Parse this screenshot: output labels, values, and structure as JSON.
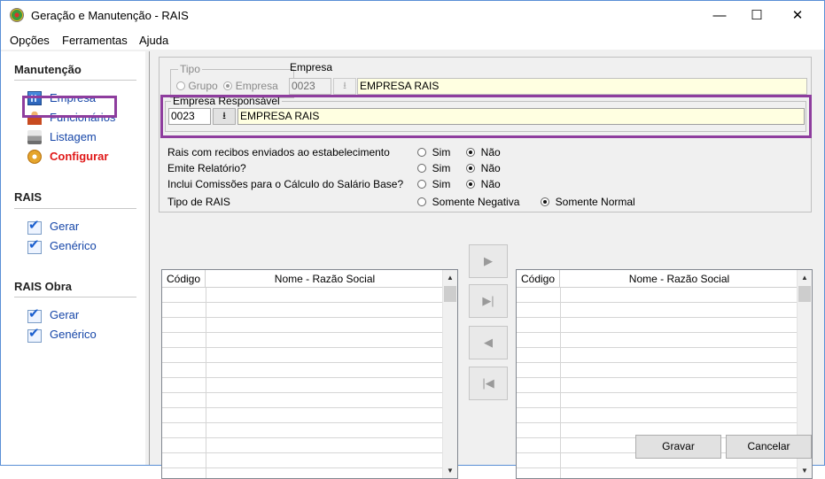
{
  "window": {
    "title": "Geração e Manutenção - RAIS",
    "minimize": "—",
    "maximize": "☐",
    "close": "✕"
  },
  "menu": {
    "items": [
      "Opções",
      "Ferramentas",
      "Ajuda"
    ]
  },
  "sidebar": {
    "sections": [
      {
        "title": "Manutenção",
        "items": [
          {
            "label": "Empresa",
            "icon": "building-icon"
          },
          {
            "label": "Funcionários",
            "icon": "person-icon"
          },
          {
            "label": "Listagem",
            "icon": "printer-icon"
          },
          {
            "label": "Configurar",
            "icon": "gear-icon",
            "active": true
          }
        ]
      },
      {
        "title": "RAIS",
        "items": [
          {
            "label": "Gerar",
            "icon": "checkbox-icon"
          },
          {
            "label": "Genérico",
            "icon": "checkbox-icon"
          }
        ]
      },
      {
        "title": "RAIS Obra",
        "items": [
          {
            "label": "Gerar",
            "icon": "checkbox-icon"
          },
          {
            "label": "Genérico",
            "icon": "checkbox-icon"
          }
        ]
      }
    ]
  },
  "config": {
    "tipo": {
      "legend": "Tipo",
      "grupo": "Grupo",
      "empresa": "Empresa",
      "selected": "Empresa"
    },
    "empresa": {
      "label": "Empresa",
      "code": "0023",
      "name": "EMPRESA RAIS"
    },
    "responsavel": {
      "legend": "Empresa Responsável",
      "code": "0023",
      "name": "EMPRESA RAIS"
    },
    "options": [
      {
        "label": "Rais com recibos enviados ao estabelecimento",
        "sim": "Sim",
        "nao": "Não",
        "selected": "Não"
      },
      {
        "label": "Emite Relatório?",
        "sim": "Sim",
        "nao": "Não",
        "selected": "Não"
      },
      {
        "label": "Inclui Comissões para o Cálculo do Salário Base?",
        "sim": "Sim",
        "nao": "Não",
        "selected": "Não"
      }
    ],
    "tipo_rais": {
      "label": "Tipo de RAIS",
      "negativa": "Somente Negativa",
      "normal": "Somente Normal",
      "selected": "Somente Normal"
    }
  },
  "grids": {
    "left": {
      "col_code": "Código",
      "col_name": "Nome - Razão Social"
    },
    "right": {
      "col_code": "Código",
      "col_name": "Nome - Razão Social"
    }
  },
  "move_buttons": [
    "▶",
    "▶|",
    "◀",
    "|◀"
  ],
  "buttons": {
    "save": "Gravar",
    "cancel": "Cancelar"
  }
}
